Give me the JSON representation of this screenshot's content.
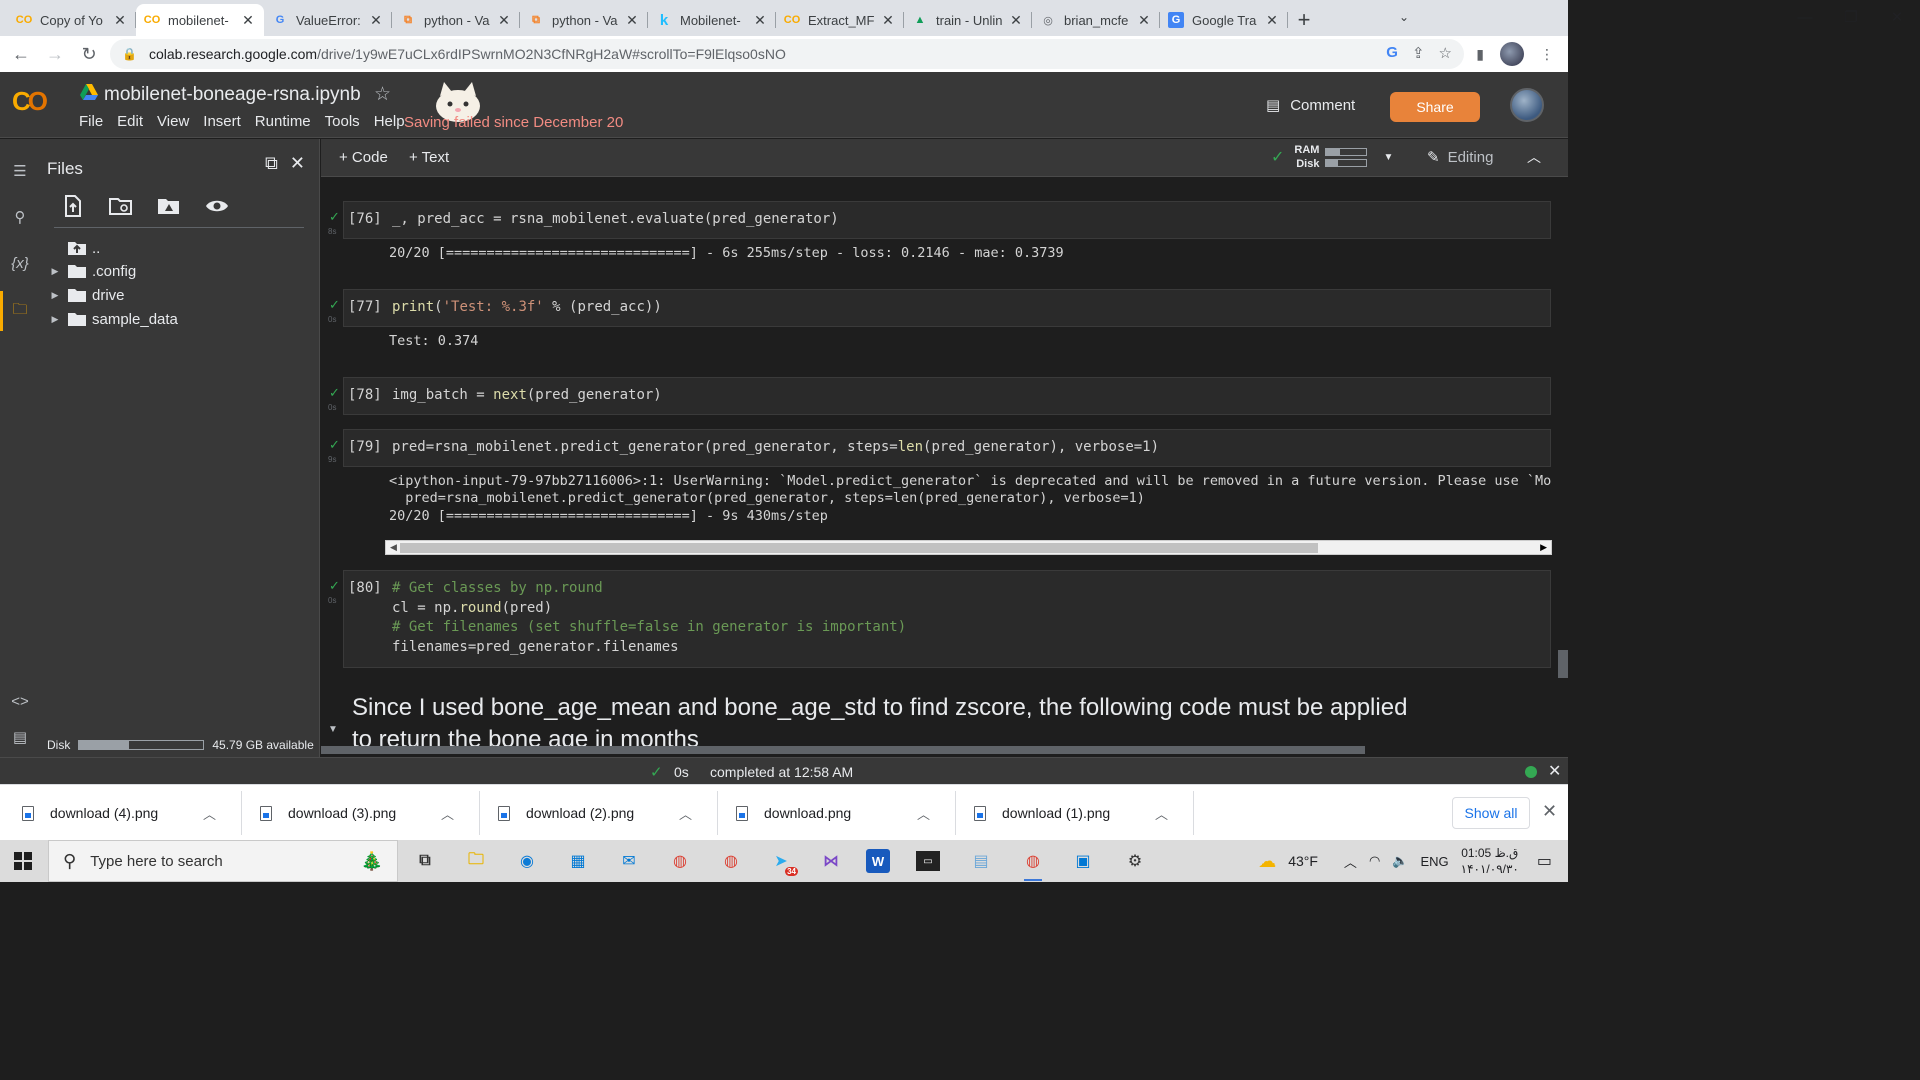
{
  "browser": {
    "tabs": [
      {
        "label": "Copy of Yo",
        "icon": "colab-icon",
        "active": false
      },
      {
        "label": "mobilenet-",
        "icon": "colab-icon",
        "active": true
      },
      {
        "label": "ValueError:",
        "icon": "google-icon",
        "active": false
      },
      {
        "label": "python - Va",
        "icon": "stackoverflow-icon",
        "active": false
      },
      {
        "label": "python - Va",
        "icon": "stackoverflow-icon",
        "active": false
      },
      {
        "label": "Mobilenet-",
        "icon": "kaggle-icon",
        "active": false
      },
      {
        "label": "Extract_MF",
        "icon": "colab-icon",
        "active": false
      },
      {
        "label": "train - Unlin",
        "icon": "drive-icon",
        "active": false
      },
      {
        "label": "brian_mcfe",
        "icon": "globe-icon",
        "active": false
      },
      {
        "label": "Google Tra",
        "icon": "translate-icon",
        "active": false
      }
    ],
    "url_host": "colab.research.google.com",
    "url_path": "/drive/1y9wE7uCLx6rdIPSwrnMO2N3CfNRgH2aW#scrollTo=F9lElqso0sNO"
  },
  "colab": {
    "notebook_title": "mobilenet-boneage-rsna.ipynb",
    "menu": [
      "File",
      "Edit",
      "View",
      "Insert",
      "Runtime",
      "Tools",
      "Help"
    ],
    "save_status": "Saving failed since December 20",
    "comment_label": "Comment",
    "share_label": "Share",
    "add_code": "+ Code",
    "add_text": "+ Text",
    "ram_label": "RAM",
    "disk_label": "Disk",
    "ram_usage": 0.35,
    "disk_usage": 0.3,
    "editing_label": "Editing"
  },
  "files_panel": {
    "title": "Files",
    "tree": [
      {
        "name": "..",
        "type": "up"
      },
      {
        "name": ".config",
        "type": "folder"
      },
      {
        "name": "drive",
        "type": "folder"
      },
      {
        "name": "sample_data",
        "type": "folder"
      }
    ],
    "disk_label": "Disk",
    "disk_available": "45.79 GB available",
    "disk_used_fraction": 0.4
  },
  "cells": [
    {
      "prompt": "[76]",
      "time": "8s",
      "code": "_, pred_acc = rsna_mobilenet.evaluate(pred_generator)",
      "output": "20/20 [==============================] - 6s 255ms/step - loss: 0.2146 - mae: 0.3739"
    },
    {
      "prompt": "[77]",
      "time": "0s",
      "code_fn": "print",
      "code_str": "'Test: %.3f'",
      "code_rest": " % (pred_acc))",
      "output": "Test: 0.374"
    },
    {
      "prompt": "[78]",
      "time": "0s",
      "code_pre": "img_batch = ",
      "code_fn": "next",
      "code_post": "(pred_generator)"
    },
    {
      "prompt": "[79]",
      "time": "9s",
      "code_pre": "pred=rsna_mobilenet.predict_generator(pred_generator, steps=",
      "code_fn": "len",
      "code_post": "(pred_generator), verbose=1)",
      "output_lines": [
        "<ipython-input-79-97bb27116006>:1: UserWarning: `Model.predict_generator` is deprecated and will be removed in a future version. Please use `Model.p",
        "  pred=rsna_mobilenet.predict_generator(pred_generator, steps=len(pred_generator), verbose=1)",
        "20/20 [==============================] - 9s 430ms/step"
      ]
    },
    {
      "prompt": "[80]",
      "time": "0s",
      "line1": "# Get classes by np.round",
      "line2_pre": "cl = np.",
      "line2_fn": "round",
      "line2_post": "(pred)",
      "line3": "# Get filenames (set shuffle=false in generator is important)",
      "line4": "filenames=pred_generator.filenames"
    }
  ],
  "markdown": {
    "line1": "Since I used bone_age_mean and bone_age_std to find zscore, the following code must be applied",
    "line2": "to return the bone age in months"
  },
  "statusbar": {
    "duration": "0s",
    "message": "completed at 12:58 AM"
  },
  "downloads": [
    "download (4).png",
    "download (3).png",
    "download (2).png",
    "download.png",
    "download (1).png"
  ],
  "downloads_show_all": "Show all",
  "taskbar": {
    "search_placeholder": "Type here to search",
    "weather": "43°F",
    "lang": "ENG",
    "time": "01:05 ق.ظ",
    "date": "۱۴۰۱/۰۹/۳۰",
    "telegram_badge": "34"
  }
}
